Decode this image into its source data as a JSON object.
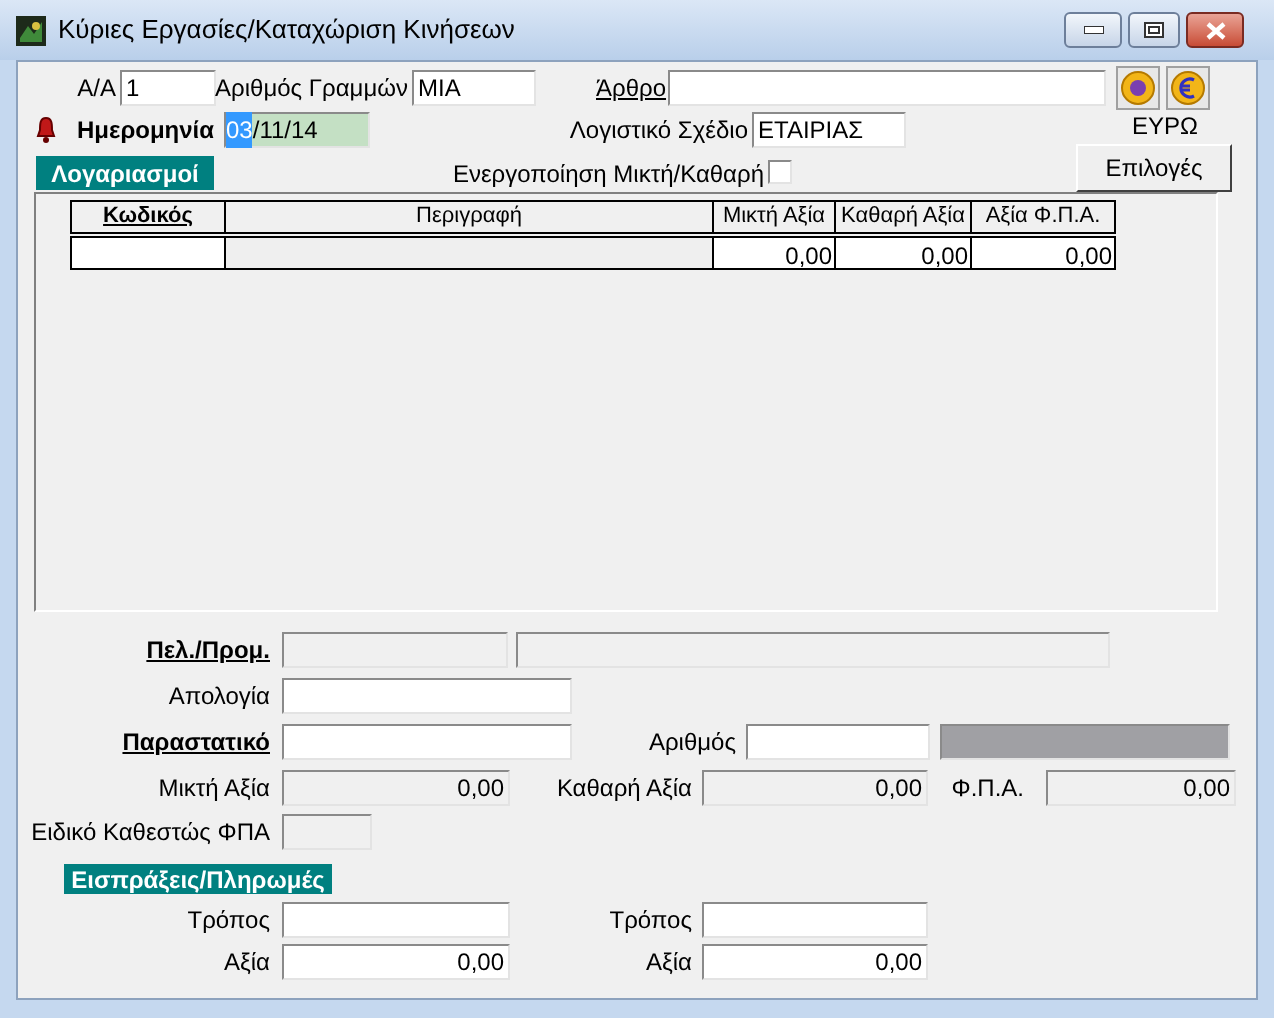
{
  "window": {
    "title": "Κύριες Εργασίες/Καταχώριση Κινήσεων"
  },
  "header": {
    "serial": {
      "label": "Α/Α",
      "value": "1",
      "disabled": false
    },
    "line_count": {
      "label": "Αριθμός Γραμμών",
      "value": "ΜΙΑ",
      "disabled": false
    },
    "article": {
      "label": "Άρθρο",
      "lookup": true,
      "disabled": false
    },
    "date": {
      "label": "Ημερομηνία",
      "value_selected": "03",
      "value_rest": "/11/14"
    },
    "chart_plan": {
      "label": "Λογιστικό Σχέδιο",
      "value": "ΕΤΑΙΡΙΑΣ",
      "disabled": false
    },
    "currency_label": "ΕΥΡΩ",
    "gross_net": {
      "label": "Ενεργοποίηση Μικτή/Καθαρή",
      "checked": false
    },
    "options_button": "Επιλογές",
    "accounts_tab": "Λογαριασμοί"
  },
  "table": {
    "columns": [
      {
        "label": "Κωδικός",
        "lookup": true
      },
      {
        "label": "Περιγραφή",
        "lookup": false
      },
      {
        "label": "Μικτή Αξία",
        "lookup": false
      },
      {
        "label": "Καθαρή Αξία",
        "lookup": false
      },
      {
        "label": "Αξία Φ.Π.Α.",
        "lookup": false
      }
    ],
    "rows": [
      {
        "gross": "0,00",
        "net": "0,00",
        "vat": "0,00"
      }
    ]
  },
  "details": {
    "customer": {
      "label": "Πελ./Προμ.",
      "lookup": true,
      "code_disabled": true,
      "name_disabled": true
    },
    "reason": {
      "label": "Απολογία",
      "lookup": false,
      "disabled": false
    },
    "document": {
      "label": "Παραστατικό",
      "lookup": true,
      "disabled": false
    },
    "number": {
      "label": "Αριθμός",
      "lookup": false,
      "disabled": false,
      "shaded": true
    },
    "gross": {
      "label": "Μικτή Αξία",
      "value": "0,00",
      "disabled": true
    },
    "net": {
      "label": "Καθαρή Αξία",
      "value": "0,00",
      "disabled": true
    },
    "vat": {
      "label": "Φ.Π.Α.",
      "value": "0,00",
      "disabled": true
    },
    "special_vat": {
      "label": "Ειδικό Καθεστώς ΦΠΑ",
      "disabled": true
    }
  },
  "payments": {
    "title": "Εισπράξεις/Πληρωμές",
    "method_1": {
      "label": "Τρόπος",
      "disabled": false
    },
    "method_2": {
      "label": "Τρόπος",
      "disabled": false
    },
    "amount_1": {
      "label": "Αξία",
      "value": "0,00",
      "disabled": false
    },
    "amount_2": {
      "label": "Αξία",
      "value": "0,00",
      "disabled": false
    }
  }
}
